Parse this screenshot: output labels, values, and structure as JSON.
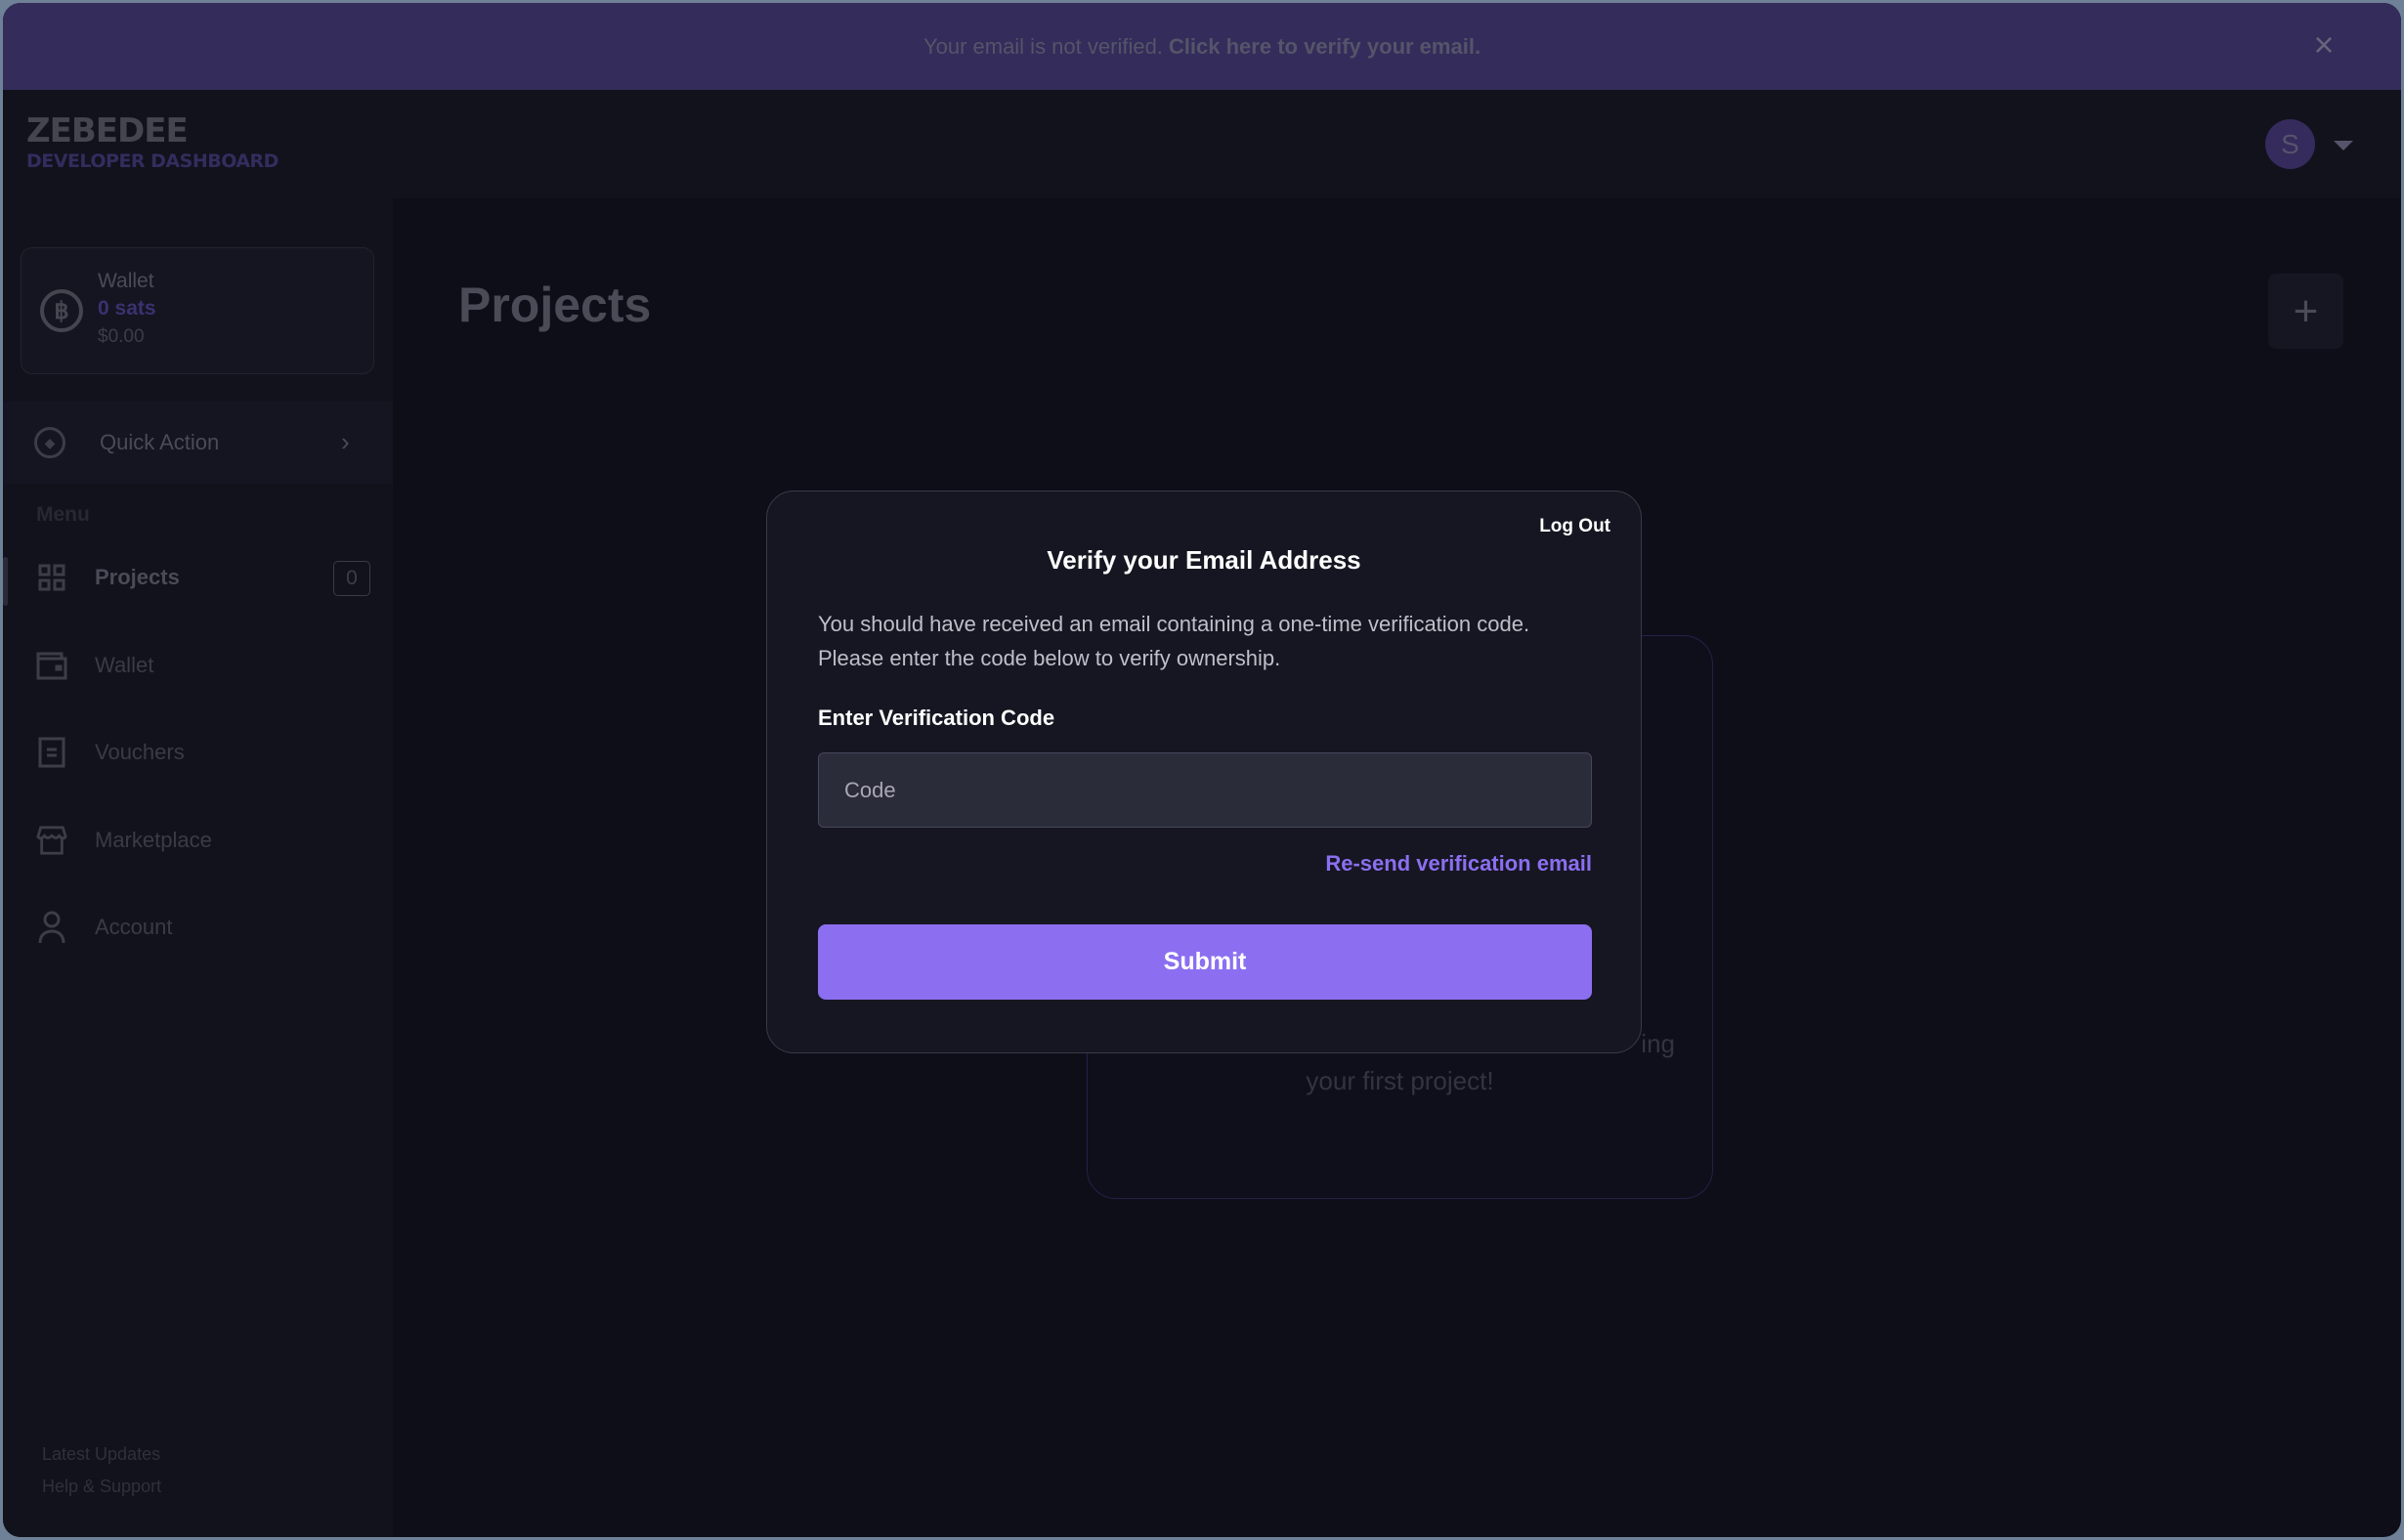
{
  "banner": {
    "text": "Your email is not verified.",
    "link": "Click here to verify your email.",
    "close_icon": "close-icon"
  },
  "header": {
    "logo_line1": "ZEBEDEE",
    "logo_line2": "DEVELOPER DASHBOARD",
    "avatar_initial": "S"
  },
  "sidebar": {
    "wallet": {
      "label": "Wallet",
      "sats": "0 sats",
      "usd": "$0.00"
    },
    "quick_action": "Quick Action",
    "menu_label": "Menu",
    "items": [
      {
        "label": "Projects",
        "badge": "0",
        "icon": "grid-icon",
        "active": true
      },
      {
        "label": "Wallet",
        "icon": "wallet-icon"
      },
      {
        "label": "Vouchers",
        "icon": "voucher-icon"
      },
      {
        "label": "Marketplace",
        "icon": "store-icon"
      },
      {
        "label": "Account",
        "icon": "user-icon"
      }
    ],
    "footer": [
      "Latest Updates",
      "Help & Support"
    ]
  },
  "main": {
    "title": "Projects",
    "add_icon": "plus-icon",
    "empty_partial": "ing",
    "empty_line2": "your first project!"
  },
  "modal": {
    "logout": "Log Out",
    "title": "Verify your Email Address",
    "desc_line1": "You should have received an email containing a one-time verification code.",
    "desc_line2": "Please enter the code below to verify ownership.",
    "field_label": "Enter Verification Code",
    "placeholder": "Code",
    "value": "",
    "resend": "Re-send verification email",
    "submit": "Submit"
  },
  "colors": {
    "accent": "#8b6ff0",
    "banner": "#342c5a",
    "modal_bg": "#161622"
  }
}
